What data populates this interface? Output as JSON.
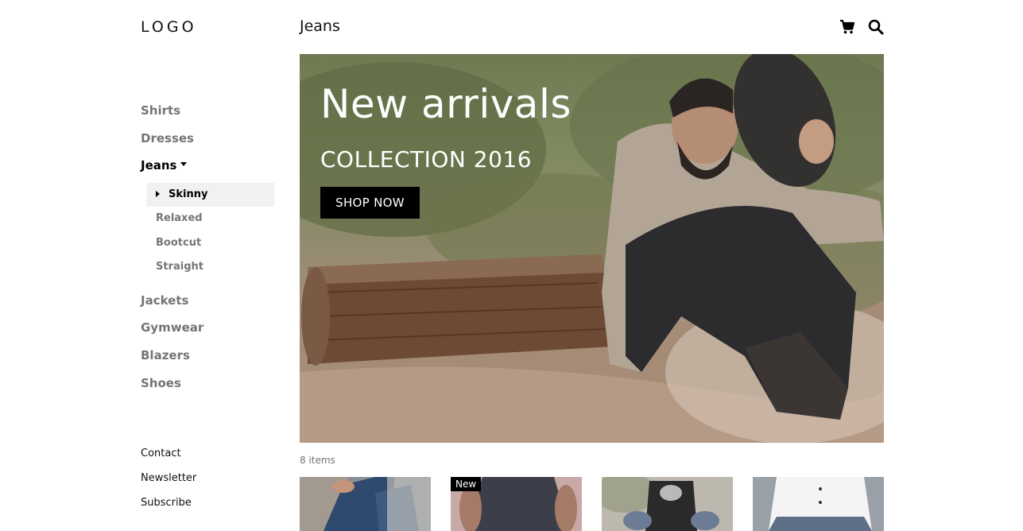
{
  "brand": {
    "logo": "LOGO"
  },
  "header": {
    "title": "Jeans",
    "cart_icon": "cart-icon",
    "search_icon": "search-icon"
  },
  "sidebar": {
    "categories": [
      {
        "label": "Shirts"
      },
      {
        "label": "Dresses"
      },
      {
        "label": "Jeans",
        "active": true,
        "subcategories": [
          {
            "label": "Skinny",
            "active": true
          },
          {
            "label": "Relaxed"
          },
          {
            "label": "Bootcut"
          },
          {
            "label": "Straight"
          }
        ]
      },
      {
        "label": "Jackets"
      },
      {
        "label": "Gymwear"
      },
      {
        "label": "Blazers"
      },
      {
        "label": "Shoes"
      }
    ],
    "footer_links": [
      "Contact",
      "Newsletter",
      "Subscribe"
    ]
  },
  "hero": {
    "title": "New arrivals",
    "subtitle": "COLLECTION 2016",
    "button_label": "SHOP NOW"
  },
  "products": {
    "count_label": "8 items",
    "items": [
      {
        "badge": ""
      },
      {
        "badge": "New"
      },
      {
        "badge": ""
      },
      {
        "badge": ""
      }
    ]
  },
  "colors": {
    "accent": "#000000",
    "muted": "#757575",
    "active_bg": "#f1f1f1"
  }
}
